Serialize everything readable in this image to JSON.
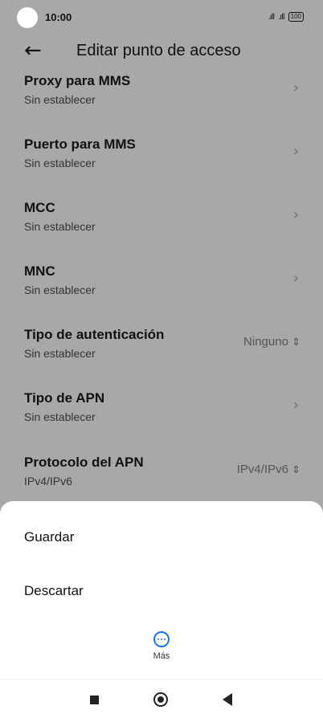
{
  "status": {
    "time": "10:00",
    "battery": "100"
  },
  "appbar": {
    "back_icon": "arrow-left-icon",
    "title": "Editar punto de acceso"
  },
  "rows": [
    {
      "title": "Proxy para MMS",
      "subtitle": "Sin establecer",
      "value": ""
    },
    {
      "title": "Puerto para MMS",
      "subtitle": "Sin establecer",
      "value": ""
    },
    {
      "title": "MCC",
      "subtitle": "Sin establecer",
      "value": ""
    },
    {
      "title": "MNC",
      "subtitle": "Sin establecer",
      "value": ""
    },
    {
      "title": "Tipo de autenticación",
      "subtitle": "Sin establecer",
      "value": "Ninguno"
    },
    {
      "title": "Tipo de APN",
      "subtitle": "Sin establecer",
      "value": ""
    },
    {
      "title": "Protocolo del APN",
      "subtitle": "IPv4/IPv6",
      "value": "IPv4/IPv6"
    }
  ],
  "sheet": {
    "save_label": "Guardar",
    "discard_label": "Descartar",
    "more_label": "Más"
  },
  "colors": {
    "accent": "#1a73e8",
    "sheet_bg": "#ffffff",
    "dim_bg": "#a8a8a8"
  }
}
